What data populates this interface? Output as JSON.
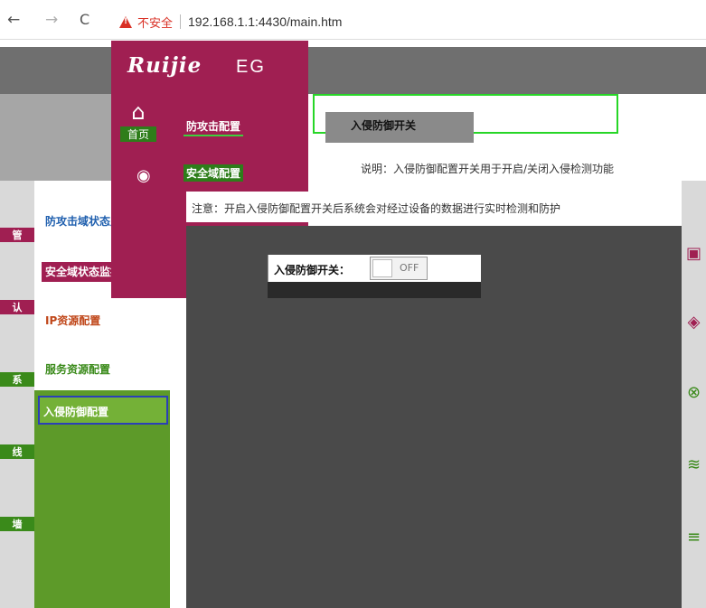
{
  "browser": {
    "back_icon": "←",
    "forward_icon": "→",
    "reload_icon": "C",
    "security_text": "不安全",
    "url": "192.168.1.1:4430/main.htm"
  },
  "brand": {
    "logo": "Ruijie",
    "suffix": "EG"
  },
  "top_menu": {
    "home_label": "首页",
    "home_icon": "home-icon",
    "items": [
      "防攻击配置",
      "安全域配置"
    ]
  },
  "sidebar": {
    "icons": [
      {
        "icon": "network-icon",
        "label": "管"
      },
      {
        "icon": "shield-icon",
        "label": "认"
      },
      {
        "icon": "gear-icon",
        "label": "系"
      },
      {
        "icon": "wifi-icon",
        "label": "线"
      },
      {
        "icon": "firewall-icon",
        "label": "墙"
      }
    ],
    "submenu": [
      "防攻击域状态监控",
      "安全域状态监控",
      "IP资源配置",
      "服务资源配置",
      "入侵防御配置"
    ]
  },
  "main": {
    "panel_title": "入侵防御开关",
    "description": "说明：入侵防御配置开关用于开启/关闭入侵检测功能",
    "warning": "注意：开启入侵防御配置开关后系统会对经过设备的数据进行实时检测和防护",
    "switch_label": "入侵防御开关：",
    "switch_state": "OFF"
  },
  "colors": {
    "brand": "#a01f52",
    "green": "#5d9a29",
    "active_border": "#2b3fb8"
  }
}
